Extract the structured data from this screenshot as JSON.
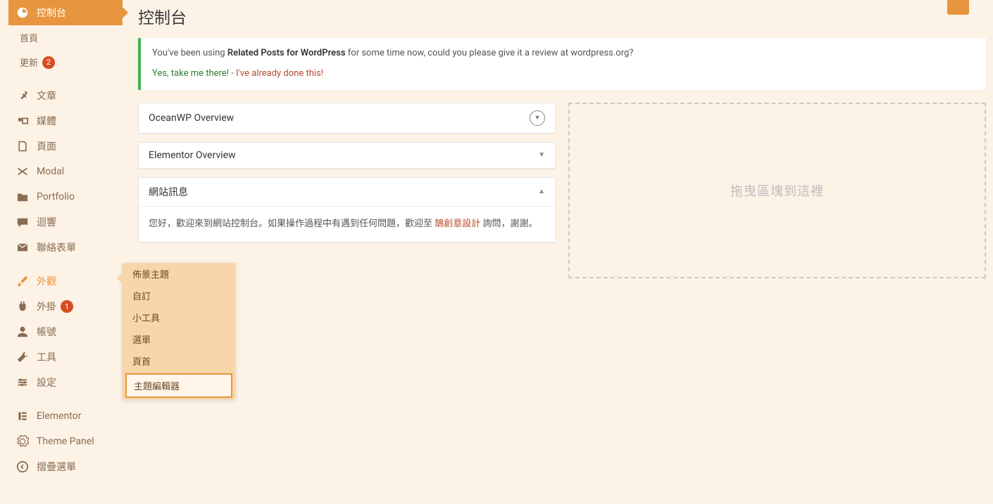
{
  "page": {
    "title": "控制台"
  },
  "sidebar": {
    "dashboard": "控制台",
    "home": "首頁",
    "updates": "更新",
    "updates_badge": "2",
    "posts": "文章",
    "media": "媒體",
    "pages": "頁面",
    "modal": "Modal",
    "portfolio": "Portfolio",
    "comments": "迴響",
    "contact": "聯絡表單",
    "appearance": "外觀",
    "plugins": "外掛",
    "plugins_badge": "1",
    "users": "帳號",
    "tools": "工具",
    "settings": "設定",
    "elementor": "Elementor",
    "theme_panel": "Theme Panel",
    "collapse": "摺疊選單"
  },
  "flyout": {
    "themes": "佈景主題",
    "customize": "自訂",
    "widgets": "小工具",
    "menus": "選單",
    "header": "頁首",
    "editor": "主題編輯器"
  },
  "notice": {
    "text1": "You've been using ",
    "bold": "Related Posts for WordPress",
    "text2": " for some time now, could you please give it a review at wordpress.org?",
    "link1": "Yes, take me there!",
    "sep": " - ",
    "link2": "I've already done this!"
  },
  "postboxes": {
    "ocean": "OceanWP Overview",
    "elementor": "Elementor Overview",
    "site_info_title": "網站訊息",
    "site_info_body1": "您好，歡迎來到網站控制台。如果操作過程中有遇到任何問題，歡迎至 ",
    "site_info_link": "鵠創意設計",
    "site_info_body2": " 詢問，謝謝。"
  },
  "dropzone": {
    "text": "拖曳區塊到這裡"
  }
}
